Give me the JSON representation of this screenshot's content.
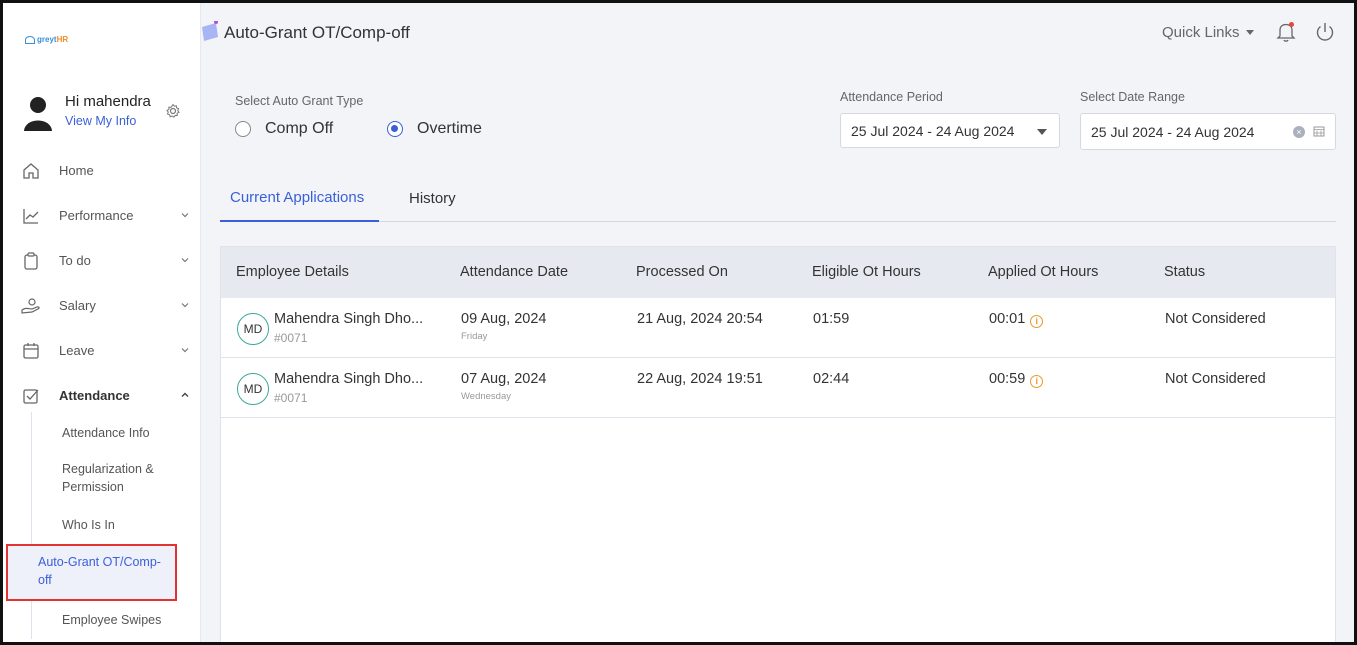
{
  "brand": {
    "logo_text_a": "greyt",
    "logo_text_b": "HR"
  },
  "user": {
    "greeting": "Hi mahendra",
    "link": "View My Info"
  },
  "nav": {
    "items": [
      {
        "label": "Home",
        "icon": "home-icon"
      },
      {
        "label": "Performance",
        "icon": "chart-icon"
      },
      {
        "label": "To do",
        "icon": "clipboard-icon"
      },
      {
        "label": "Salary",
        "icon": "salary-icon"
      },
      {
        "label": "Leave",
        "icon": "calendar-icon"
      },
      {
        "label": "Attendance",
        "icon": "checkbox-icon"
      }
    ],
    "sub_items": [
      "Attendance Info",
      "Regularization & Permission",
      "Who Is In",
      "Auto-Grant OT/Comp-off",
      "Employee Swipes"
    ]
  },
  "header": {
    "title": "Auto-Grant OT/Comp-off",
    "quick_links": "Quick Links"
  },
  "filters": {
    "grant_type_label": "Select Auto Grant Type",
    "options": [
      "Comp Off",
      "Overtime"
    ],
    "selected": "Overtime",
    "period_label": "Attendance Period",
    "period_value": "25 Jul 2024 - 24 Aug 2024",
    "range_label": "Select Date Range",
    "range_value": "25 Jul 2024 - 24 Aug 2024"
  },
  "tabs": [
    "Current Applications",
    "History"
  ],
  "table": {
    "columns": [
      "Employee Details",
      "Attendance Date",
      "Processed On",
      "Eligible Ot Hours",
      "Applied Ot Hours",
      "Status"
    ],
    "rows": [
      {
        "initials": "MD",
        "name": "Mahendra Singh Dho...",
        "id": "#0071",
        "date": "09 Aug, 2024",
        "day": "Friday",
        "processed": "21 Aug, 2024 20:54",
        "eligible": "01:59",
        "applied": "00:01",
        "status": "Not Considered"
      },
      {
        "initials": "MD",
        "name": "Mahendra Singh Dho...",
        "id": "#0071",
        "date": "07 Aug, 2024",
        "day": "Wednesday",
        "processed": "22 Aug, 2024 19:51",
        "eligible": "02:44",
        "applied": "00:59",
        "status": "Not Considered"
      }
    ]
  },
  "colors": {
    "accent": "#3b5fd9",
    "highlight": "#e23232",
    "info": "#e89a2c"
  }
}
